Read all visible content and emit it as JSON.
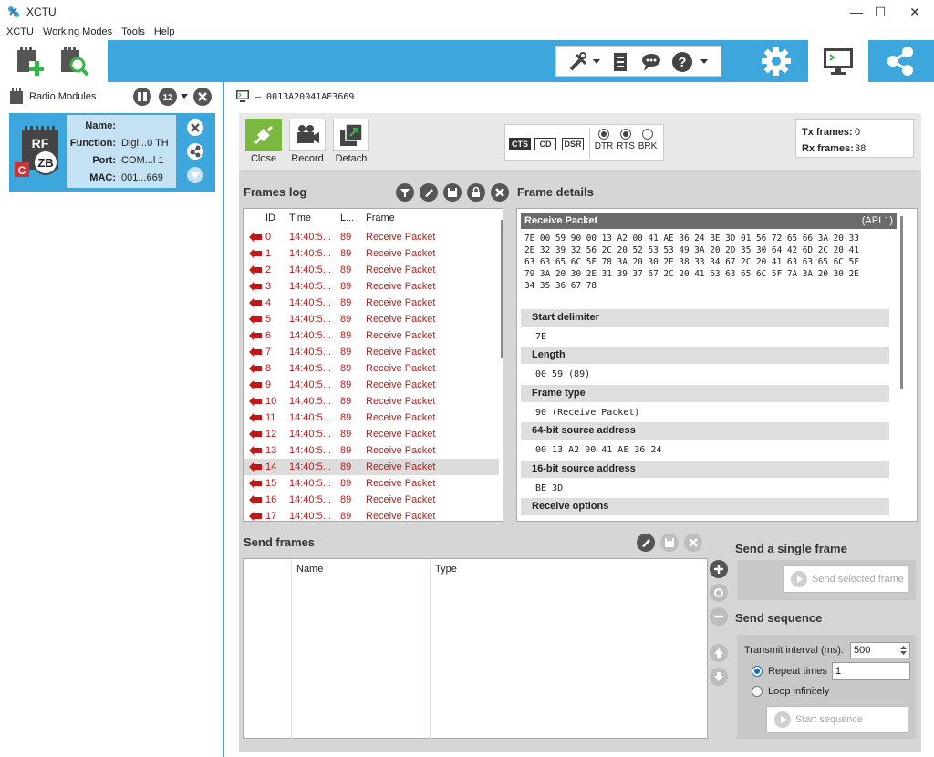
{
  "window": {
    "title": "XCTU",
    "minimize": "—",
    "maximize": "☐",
    "close": "✕"
  },
  "menu": [
    "XCTU",
    "Working Modes",
    "Tools",
    "Help"
  ],
  "radio_modules": {
    "label": "Radio Modules",
    "module": {
      "name_label": "Name:",
      "name_value": "",
      "function_label": "Function:",
      "function_value": "Digi...0 TH",
      "port_label": "Port:",
      "port_value": "COM...l 1",
      "mac_label": "MAC:",
      "mac_value": "001...669",
      "icon_text_top": "RF",
      "icon_text_zb": "ZB",
      "icon_text_c": "C"
    }
  },
  "console": {
    "address": "0013A20041AE3669",
    "actions": {
      "close": "Close",
      "record": "Record",
      "detach": "Detach"
    },
    "lines": {
      "cts": "CTS",
      "cd": "CD",
      "dsr": "DSR",
      "dtr": "DTR",
      "rts": "RTS",
      "brk": "BRK"
    },
    "tx_label": "Tx frames:",
    "tx_value": "0",
    "rx_label": "Rx frames:",
    "rx_value": "38"
  },
  "frames_log": {
    "title": "Frames log",
    "columns": {
      "id": "ID",
      "time": "Time",
      "length": "L...",
      "frame": "Frame"
    },
    "rows": [
      {
        "id": "0",
        "time": "14:40:5...",
        "length": "89",
        "frame": "Receive Packet"
      },
      {
        "id": "1",
        "time": "14:40:5...",
        "length": "89",
        "frame": "Receive Packet"
      },
      {
        "id": "2",
        "time": "14:40:5...",
        "length": "89",
        "frame": "Receive Packet"
      },
      {
        "id": "3",
        "time": "14:40:5...",
        "length": "89",
        "frame": "Receive Packet"
      },
      {
        "id": "4",
        "time": "14:40:5...",
        "length": "89",
        "frame": "Receive Packet"
      },
      {
        "id": "5",
        "time": "14:40:5...",
        "length": "89",
        "frame": "Receive Packet"
      },
      {
        "id": "6",
        "time": "14:40:5...",
        "length": "89",
        "frame": "Receive Packet"
      },
      {
        "id": "7",
        "time": "14:40:5...",
        "length": "89",
        "frame": "Receive Packet"
      },
      {
        "id": "8",
        "time": "14:40:5...",
        "length": "89",
        "frame": "Receive Packet"
      },
      {
        "id": "9",
        "time": "14:40:5...",
        "length": "89",
        "frame": "Receive Packet"
      },
      {
        "id": "10",
        "time": "14:40:5...",
        "length": "89",
        "frame": "Receive Packet"
      },
      {
        "id": "11",
        "time": "14:40:5...",
        "length": "89",
        "frame": "Receive Packet"
      },
      {
        "id": "12",
        "time": "14:40:5...",
        "length": "89",
        "frame": "Receive Packet"
      },
      {
        "id": "13",
        "time": "14:40:5...",
        "length": "89",
        "frame": "Receive Packet"
      },
      {
        "id": "14",
        "time": "14:40:5...",
        "length": "89",
        "frame": "Receive Packet"
      },
      {
        "id": "15",
        "time": "14:40:5...",
        "length": "89",
        "frame": "Receive Packet"
      },
      {
        "id": "16",
        "time": "14:40:5...",
        "length": "89",
        "frame": "Receive Packet"
      },
      {
        "id": "17",
        "time": "14:40:5...",
        "length": "89",
        "frame": "Receive Packet"
      }
    ],
    "selected_index": 14
  },
  "frame_details": {
    "title": "Frame details",
    "header": "Receive Packet",
    "api": "(API 1)",
    "hex": "7E 00 59 90 00 13 A2 00 41 AE 36 24 BE 3D 01 56 72 65 66 3A 20 33\n2E 32 39 32 56 2C 20 52 53 53 49 3A 20 2D 35 30 64 42 6D 2C 20 41\n63 63 65 6C 5F 78 3A 20 30 2E 38 33 34 67 2C 20 41 63 63 65 6C 5F\n79 3A 20 30 2E 31 39 37 67 2C 20 41 63 63 65 6C 5F 7A 3A 20 30 2E\n34 35 36 67 78",
    "fields": [
      {
        "label": "Start delimiter",
        "value": "7E"
      },
      {
        "label": "Length",
        "value": "00 59 (89)"
      },
      {
        "label": "Frame type",
        "value": "90 (Receive Packet)"
      },
      {
        "label": "64-bit source address",
        "value": "00 13 A2 00 41 AE 36 24"
      },
      {
        "label": "16-bit source address",
        "value": "BE 3D"
      },
      {
        "label": "Receive options",
        "value": ""
      }
    ]
  },
  "send_frames": {
    "title": "Send frames",
    "columns": {
      "name": "Name",
      "type": "Type"
    }
  },
  "single_frame": {
    "title": "Send a single frame",
    "button": "Send selected frame"
  },
  "sequence": {
    "title": "Send sequence",
    "interval_label": "Transmit interval (ms):",
    "interval_value": "500",
    "repeat_label": "Repeat times",
    "repeat_value": "1",
    "loop_label": "Loop infinitely",
    "start_button": "Start sequence",
    "mode": "repeat"
  },
  "colors": {
    "accent": "#3da6dc",
    "frame_text": "#b02020",
    "close_green": "#7ab840"
  }
}
